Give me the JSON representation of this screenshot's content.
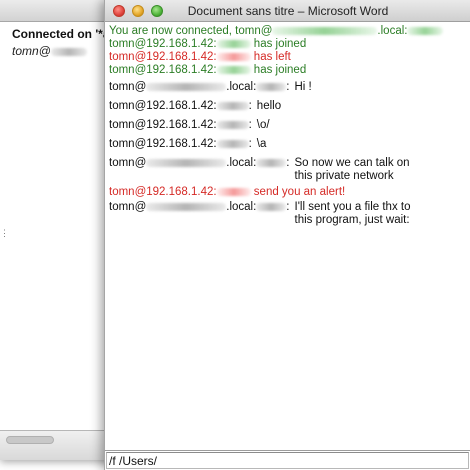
{
  "back_window": {
    "connected_label": "Connected on '*all",
    "user_prefix": "tomn@"
  },
  "front_window": {
    "title": "Document sans titre – Microsoft Word",
    "messages": {
      "connected": {
        "prefix": "You are now connected, tomn@",
        "suffix": ".local:"
      },
      "joined_1": {
        "prefix": "tomn@192.168.1.42:",
        "text": "has joined"
      },
      "left": {
        "prefix": "tomn@192.168.1.42:",
        "text": "has left"
      },
      "joined_2": {
        "prefix": "tomn@192.168.1.42:",
        "text": "has joined"
      },
      "hi": {
        "prefix": "tomn@",
        "mid": ".local:",
        "sep": ":",
        "text": "Hi !"
      },
      "hello": {
        "prefix": "tomn@192.168.1.42:",
        "sep": ":",
        "text": "hello"
      },
      "o": {
        "prefix": "tomn@192.168.1.42:",
        "sep": ":",
        "text": "\\o/"
      },
      "a": {
        "prefix": "tomn@192.168.1.42:",
        "sep": ":",
        "text": "\\a"
      },
      "network": {
        "prefix": "tomn@",
        "mid": ".local:",
        "sep": ":",
        "text": "So now we can talk on this private network"
      },
      "alert": {
        "prefix": "tomn@192.168.1.42:",
        "text": "send you an alert!"
      },
      "file": {
        "prefix": "tomn@",
        "mid": ".local:",
        "sep": ":",
        "text": "I'll sent you a file thx to this program, just wait:"
      }
    },
    "input": {
      "value": "/f /Users/"
    }
  },
  "colors": {
    "system_green": "#2b7d25",
    "alert_red": "#d52a26"
  }
}
